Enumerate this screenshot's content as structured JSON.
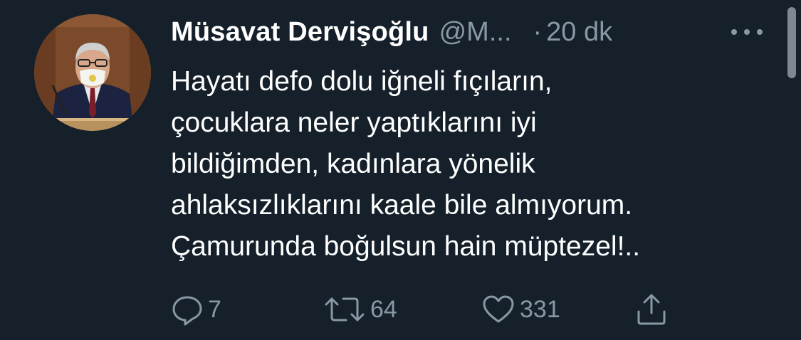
{
  "author": {
    "display_name": "Müsavat Dervişoğlu",
    "handle": "@M...",
    "separator": "·",
    "time": "20 dk"
  },
  "tweet": {
    "lines": [
      "Hayatı defo dolu iğneli fıçıların,",
      "çocuklara neler yaptıklarını iyi",
      "bildiğimden, kadınlara yönelik",
      "ahlaksızlıklarını kaale bile almıyorum.",
      "Çamurunda boğulsun hain müptezel!.."
    ]
  },
  "actions": {
    "reply_count": "7",
    "retweet_count": "64",
    "like_count": "331"
  },
  "icons": [
    "reply-icon",
    "retweet-icon",
    "like-icon",
    "share-icon",
    "more-icon"
  ],
  "colors": {
    "background": "#15202b",
    "primary_text": "#ffffff",
    "secondary_text": "#8899a6"
  }
}
